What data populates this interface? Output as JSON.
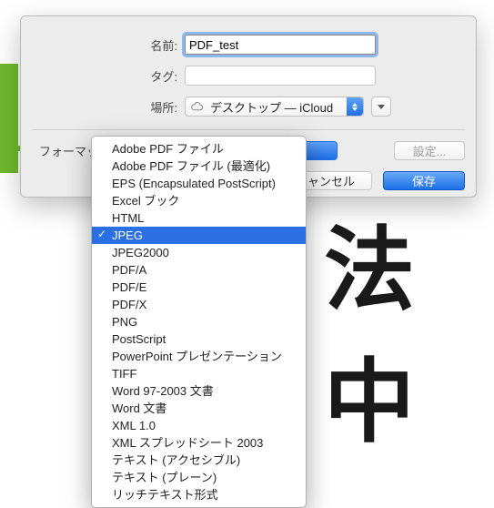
{
  "bg": {
    "glyph1": "法",
    "glyph2": "中"
  },
  "labels": {
    "name": "名前:",
    "tags": "タグ:",
    "location": "場所:",
    "format": "フォーマット:"
  },
  "fields": {
    "name_value": "PDF_test",
    "tags_value": "",
    "location_value": "デスクトップ — iCloud"
  },
  "buttons": {
    "settings": "設定...",
    "cancel": "ャンセル",
    "save": "保存"
  },
  "format_options": [
    "Adobe PDF ファイル",
    "Adobe PDF ファイル (最適化)",
    "EPS (Encapsulated PostScript)",
    "Excel ブック",
    "HTML",
    "JPEG",
    "JPEG2000",
    "PDF/A",
    "PDF/E",
    "PDF/X",
    "PNG",
    "PostScript",
    "PowerPoint プレゼンテーション",
    "TIFF",
    "Word 97-2003 文書",
    "Word 文書",
    "XML 1.0",
    "XML スプレッドシート 2003",
    "テキスト (アクセシブル)",
    "テキスト (プレーン)",
    "リッチテキスト形式"
  ],
  "format_selected_index": 5
}
